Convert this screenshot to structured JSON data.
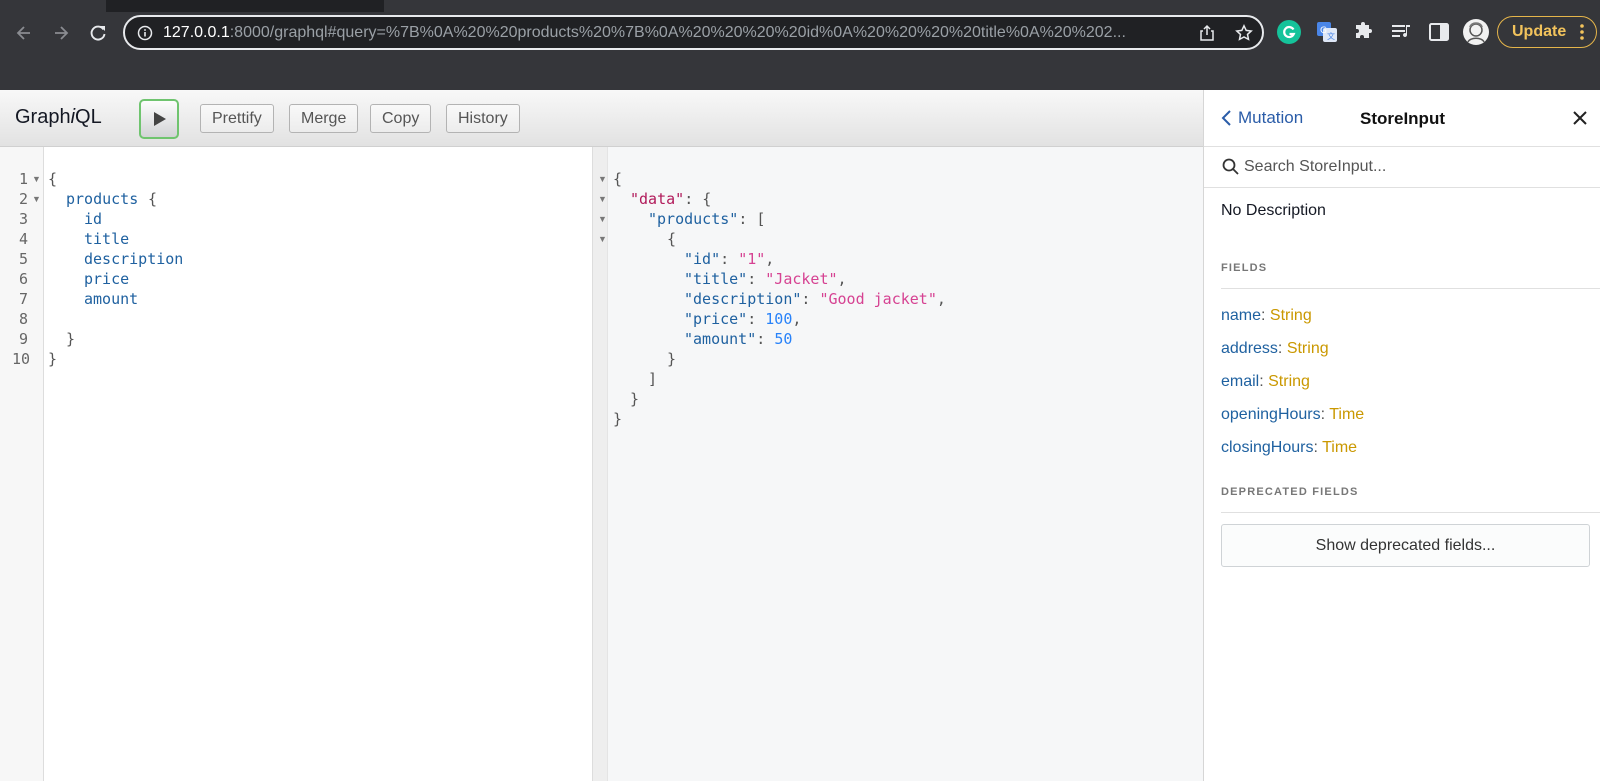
{
  "browser": {
    "url_host": "127.0.0.1",
    "url_rest": ":8000/graphql#query=%7B%0A%20%20products%20%7B%0A%20%20%20%20id%0A%20%20%20%20title%0A%20%202...",
    "update_label": "Update",
    "accent": "#e5b54a"
  },
  "graphiql": {
    "title_pre": "Graph",
    "title_i": "i",
    "title_post": "QL",
    "buttons": {
      "prettify": "Prettify",
      "merge": "Merge",
      "copy": "Copy",
      "history": "History"
    }
  },
  "query_editor": {
    "line_numbers": [
      "1",
      "2",
      "3",
      "4",
      "5",
      "6",
      "7",
      "8",
      "9",
      "10"
    ],
    "lines": [
      "{",
      "products",
      "{",
      "id",
      "title",
      "description",
      "price",
      "amount",
      "}",
      "}"
    ]
  },
  "result": {
    "open_brace": "{",
    "data_key": "\"data\"",
    "products_key": "\"products\"",
    "keys": {
      "id": "\"id\"",
      "title": "\"title\"",
      "description": "\"description\"",
      "price": "\"price\"",
      "amount": "\"amount\""
    },
    "values": {
      "id": "\"1\"",
      "title": "\"Jacket\"",
      "description": "\"Good jacket\"",
      "price": "100",
      "amount": "50"
    }
  },
  "docs": {
    "back_label": "Mutation",
    "title": "StoreInput",
    "search_placeholder": "Search StoreInput...",
    "description": "No Description",
    "fields_heading": "FIELDS",
    "fields": [
      {
        "name": "name",
        "type": "String"
      },
      {
        "name": "address",
        "type": "String"
      },
      {
        "name": "email",
        "type": "String"
      },
      {
        "name": "openingHours",
        "type": "Time"
      },
      {
        "name": "closingHours",
        "type": "Time"
      }
    ],
    "deprecated_heading": "DEPRECATED FIELDS",
    "show_deprecated_label": "Show deprecated fields..."
  }
}
